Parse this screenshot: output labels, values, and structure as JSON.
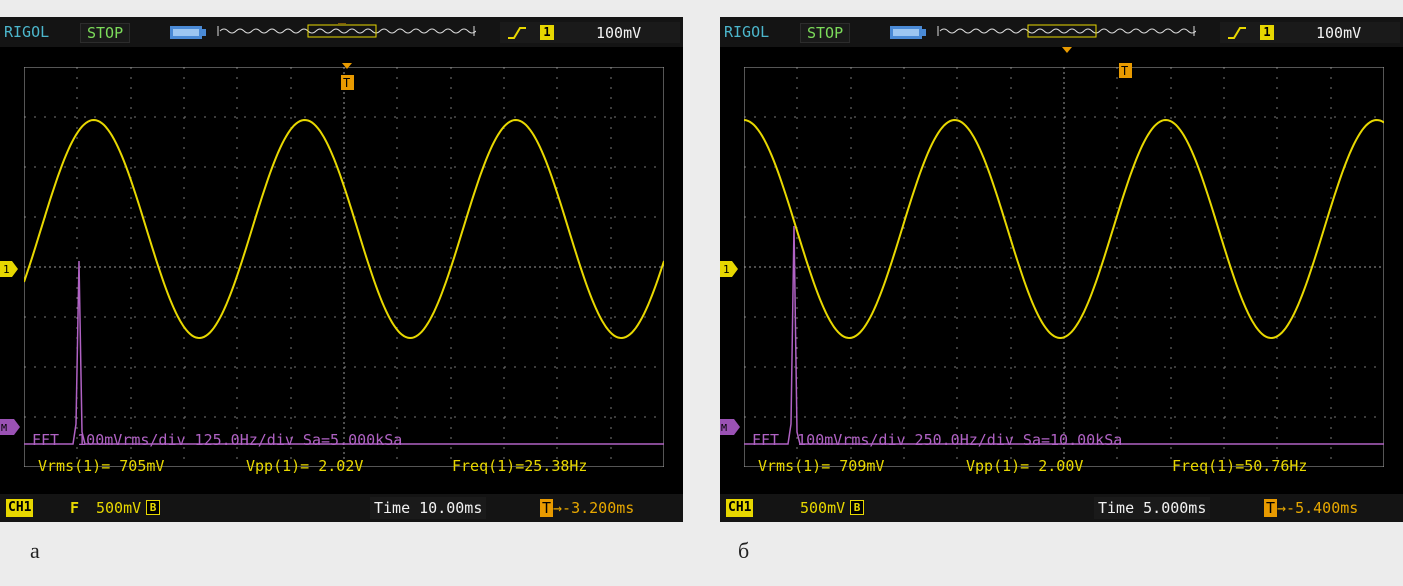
{
  "colors": {
    "trace": "#e8d800",
    "fft": "#b062c4",
    "grid": "#888888",
    "trigger": "#e89a00",
    "brand": "#4cb6cc",
    "status": "#7cdc5a"
  },
  "scopes": [
    {
      "brand": "RIGOL",
      "status": "STOP",
      "trigger_channel": "1",
      "trigger_level": "100mV",
      "fft_line": "FFT  100mVrms/div 125.0Hz/div Sa=5.000kSa",
      "vrms": "Vrms(1)= 705mV",
      "vpp": "Vpp(1)= 2.02V",
      "freq": "Freq(1)=25.38Hz",
      "ch1_label": "CH1",
      "ch1_coupling": "F",
      "volts_div": "500mV",
      "bw_icon": "B",
      "time": "Time 10.00ms",
      "offset": "→-3.200ms",
      "caption": "а"
    },
    {
      "brand": "RIGOL",
      "status": "STOP",
      "trigger_channel": "1",
      "trigger_level": "100mV",
      "fft_line": "FFT  100mVrms/div 250.0Hz/div Sa=10.00kSa",
      "vrms": "Vrms(1)= 709mV",
      "vpp": "Vpp(1)= 2.00V",
      "freq": "Freq(1)=50.76Hz",
      "ch1_label": "CH1",
      "ch1_coupling": "",
      "volts_div": "500mV",
      "bw_icon": "B",
      "time": "Time 5.000ms",
      "offset": "→-5.400ms",
      "caption": "б"
    }
  ]
}
